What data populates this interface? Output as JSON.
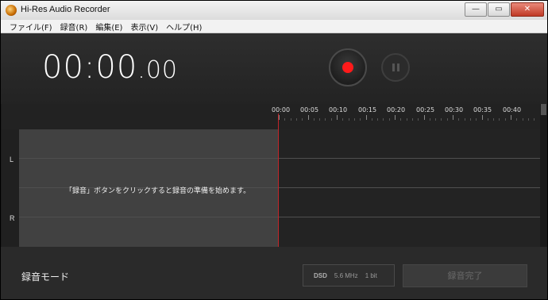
{
  "window": {
    "title": "Hi-Res Audio Recorder",
    "controls": {
      "minimize": "—",
      "maximize": "▭",
      "close": "✕"
    }
  },
  "menu": [
    {
      "label": "ファイル(F)"
    },
    {
      "label": "録音(R)"
    },
    {
      "label": "編集(E)"
    },
    {
      "label": "表示(V)"
    },
    {
      "label": "ヘルプ(H)"
    }
  ],
  "timer": {
    "main": "00:00",
    "fraction": ".00"
  },
  "ruler": {
    "ticks": [
      "00:00",
      "00:05",
      "00:10",
      "00:15",
      "00:20",
      "00:25",
      "00:30",
      "00:35",
      "00:40"
    ]
  },
  "track": {
    "channel_left": "L",
    "channel_right": "R",
    "hint": "「録音」ボタンをクリックすると録音の準備を始めます。"
  },
  "bottom": {
    "mode_label": "録音モード",
    "format": {
      "type": "DSD",
      "rate": "5.6 MHz",
      "bits": "1 bit"
    },
    "finish_button": "録音完了"
  },
  "colors": {
    "record": "#ff1a1a",
    "playhead": "#c0252a",
    "background": "#1b1b1b"
  }
}
